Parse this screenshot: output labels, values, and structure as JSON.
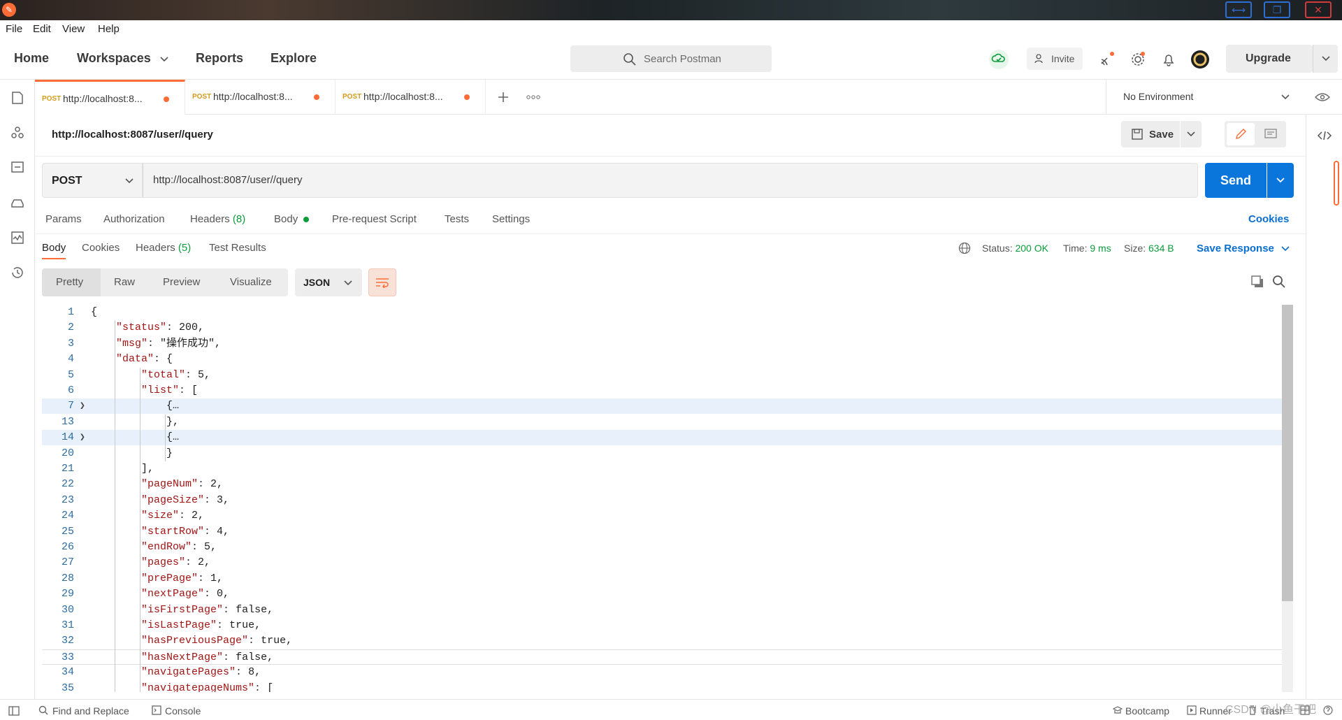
{
  "window": {
    "minimize_glyph": "⟷",
    "restore_glyph": "❐",
    "close_glyph": "✕"
  },
  "menu": [
    "File",
    "Edit",
    "View",
    "Help"
  ],
  "nav": {
    "home": "Home",
    "workspaces": "Workspaces",
    "reports": "Reports",
    "explore": "Explore"
  },
  "search": {
    "placeholder": "Search Postman"
  },
  "header": {
    "invite": "Invite",
    "upgrade": "Upgrade"
  },
  "tabs": [
    {
      "method": "POST",
      "url": "http://localhost:8..."
    },
    {
      "method": "POST",
      "url": "http://localhost:8..."
    },
    {
      "method": "POST",
      "url": "http://localhost:8..."
    }
  ],
  "environment": {
    "selected": "No Environment"
  },
  "request": {
    "title": "http://localhost:8087/user//query",
    "method": "POST",
    "url": "http://localhost:8087/user//query",
    "save_label": "Save",
    "send_label": "Send"
  },
  "request_tabs": {
    "params": "Params",
    "authorization": "Authorization",
    "headers": "Headers",
    "headers_count": "(8)",
    "body": "Body",
    "prerequest": "Pre-request Script",
    "tests": "Tests",
    "settings": "Settings",
    "cookies": "Cookies"
  },
  "response_tabs": {
    "body": "Body",
    "cookies": "Cookies",
    "headers": "Headers",
    "headers_count": "(5)",
    "test_results": "Test Results"
  },
  "response_meta": {
    "status_label": "Status:",
    "status_value": "200 OK",
    "time_label": "Time:",
    "time_value": "9 ms",
    "size_label": "Size:",
    "size_value": "634 B",
    "save_response": "Save Response"
  },
  "view_modes": {
    "pretty": "Pretty",
    "raw": "Raw",
    "preview": "Preview",
    "visualize": "Visualize",
    "format": "JSON"
  },
  "code_lines": [
    {
      "n": "1",
      "text": "{"
    },
    {
      "n": "2",
      "text": "    \"status\": 200,"
    },
    {
      "n": "3",
      "text": "    \"msg\": \"操作成功\","
    },
    {
      "n": "4",
      "text": "    \"data\": {"
    },
    {
      "n": "5",
      "text": "        \"total\": 5,"
    },
    {
      "n": "6",
      "text": "        \"list\": ["
    },
    {
      "n": "7",
      "text": "            {…"
    },
    {
      "n": "13",
      "text": "            },"
    },
    {
      "n": "14",
      "text": "            {…"
    },
    {
      "n": "20",
      "text": "            }"
    },
    {
      "n": "21",
      "text": "        ],"
    },
    {
      "n": "22",
      "text": "        \"pageNum\": 2,"
    },
    {
      "n": "23",
      "text": "        \"pageSize\": 3,"
    },
    {
      "n": "24",
      "text": "        \"size\": 2,"
    },
    {
      "n": "25",
      "text": "        \"startRow\": 4,"
    },
    {
      "n": "26",
      "text": "        \"endRow\": 5,"
    },
    {
      "n": "27",
      "text": "        \"pages\": 2,"
    },
    {
      "n": "28",
      "text": "        \"prePage\": 1,"
    },
    {
      "n": "29",
      "text": "        \"nextPage\": 0,"
    },
    {
      "n": "30",
      "text": "        \"isFirstPage\": false,"
    },
    {
      "n": "31",
      "text": "        \"isLastPage\": true,"
    },
    {
      "n": "32",
      "text": "        \"hasPreviousPage\": true,"
    },
    {
      "n": "33",
      "text": "        \"hasNextPage\": false,"
    },
    {
      "n": "34",
      "text": "        \"navigatePages\": 8,"
    },
    {
      "n": "35",
      "text": "        \"navigatepageNums\": ["
    }
  ],
  "statusbar": {
    "find_replace": "Find and Replace",
    "console": "Console",
    "bootcamp": "Bootcamp",
    "runner": "Runner",
    "trash": "Trash"
  },
  "watermark": "CSDN @小鱼干吧"
}
